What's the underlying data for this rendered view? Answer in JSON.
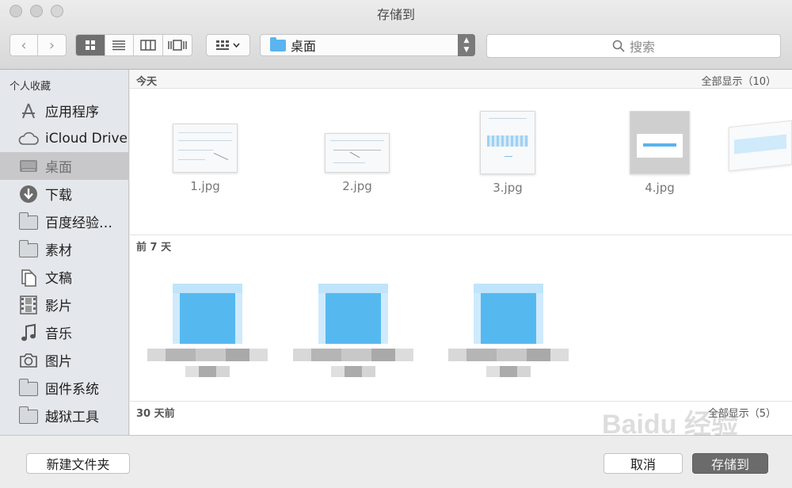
{
  "window": {
    "title": "存储到"
  },
  "toolbar": {
    "back_icon": "‹",
    "forward_icon": "›",
    "location": "桌面",
    "search_placeholder": "搜索"
  },
  "sidebar": {
    "heading": "个人收藏",
    "items": [
      {
        "label": "应用程序",
        "icon": "applications-icon"
      },
      {
        "label": "iCloud Drive",
        "icon": "cloud-icon"
      },
      {
        "label": "桌面",
        "icon": "desktop-icon",
        "selected": true
      },
      {
        "label": "下载",
        "icon": "download-icon"
      },
      {
        "label": "百度经验…",
        "icon": "folder-icon"
      },
      {
        "label": "素材",
        "icon": "folder-icon"
      },
      {
        "label": "文稿",
        "icon": "documents-icon"
      },
      {
        "label": "影片",
        "icon": "movies-icon"
      },
      {
        "label": "音乐",
        "icon": "music-icon"
      },
      {
        "label": "图片",
        "icon": "camera-icon"
      },
      {
        "label": "固件系统",
        "icon": "folder-icon"
      },
      {
        "label": "越狱工具",
        "icon": "folder-icon"
      }
    ]
  },
  "sections": {
    "today": {
      "label": "今天",
      "show_all": "全部显示（10）"
    },
    "week": {
      "label": "前 7 天"
    },
    "month": {
      "label": "30 天前",
      "show_all": "全部显示（5）"
    }
  },
  "files": [
    "1.jpg",
    "2.jpg",
    "3.jpg",
    "4.jpg"
  ],
  "buttons": {
    "new_folder": "新建文件夹",
    "cancel": "取消",
    "save": "存储到"
  },
  "watermark": "Baidu 经验"
}
